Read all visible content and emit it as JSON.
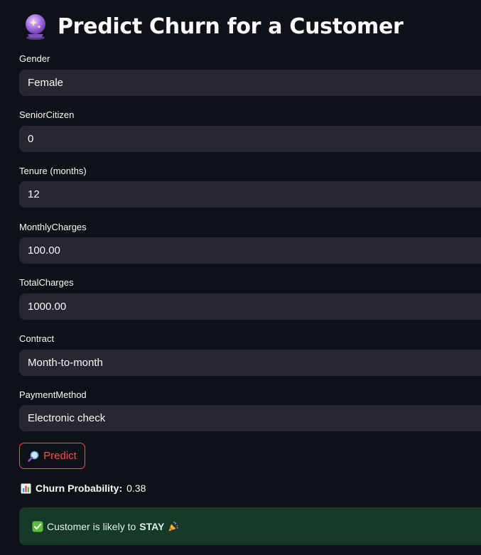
{
  "header": {
    "title": "Predict Churn for a Customer",
    "icon": "crystal-ball-icon"
  },
  "form": {
    "fields": [
      {
        "label": "Gender",
        "value": "Female"
      },
      {
        "label": "SeniorCitizen",
        "value": "0"
      },
      {
        "label": "Tenure (months)",
        "value": "12"
      },
      {
        "label": "MonthlyCharges",
        "value": "100.00"
      },
      {
        "label": "TotalCharges",
        "value": "1000.00"
      },
      {
        "label": "Contract",
        "value": "Month-to-month"
      },
      {
        "label": "PaymentMethod",
        "value": "Electronic check"
      }
    ]
  },
  "predict_button": {
    "label": "Predict",
    "icon": "magnifier-icon"
  },
  "result": {
    "icon": "bar-chart-icon",
    "probability_label": "Churn Probability:",
    "probability_value": "0.38"
  },
  "alert": {
    "icon": "check-mark-icon",
    "text_prefix": "Customer is likely to",
    "text_strong": "STAY",
    "trailing_icon": "party-popper-icon"
  },
  "colors": {
    "background": "#0e1117",
    "field_bg": "#262730",
    "accent": "#ff4b4b",
    "success_bg": "#173928"
  }
}
